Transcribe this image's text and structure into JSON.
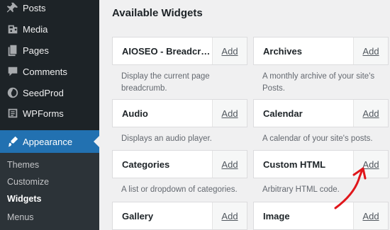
{
  "sidebar": {
    "items": [
      {
        "label": "Posts",
        "icon": "pushpin-icon"
      },
      {
        "label": "Media",
        "icon": "media-icon"
      },
      {
        "label": "Pages",
        "icon": "pages-icon"
      },
      {
        "label": "Comments",
        "icon": "comments-icon"
      },
      {
        "label": "SeedProd",
        "icon": "seedprod-icon"
      },
      {
        "label": "WPForms",
        "icon": "wpforms-icon"
      },
      {
        "label": "Appearance",
        "icon": "paintbrush-icon"
      }
    ],
    "submenu": [
      "Themes",
      "Customize",
      "Widgets",
      "Menus"
    ]
  },
  "main": {
    "title": "Available Widgets",
    "add_label": "Add",
    "widgets": [
      {
        "name": "AIOSEO - Breadcrumbs",
        "desc": "Display the current page breadcrumb."
      },
      {
        "name": "Archives",
        "desc": "A monthly archive of your site's Posts."
      },
      {
        "name": "Audio",
        "desc": "Displays an audio player."
      },
      {
        "name": "Calendar",
        "desc": "A calendar of your site's posts."
      },
      {
        "name": "Categories",
        "desc": "A list or dropdown of categories."
      },
      {
        "name": "Custom HTML",
        "desc": "Arbitrary HTML code."
      },
      {
        "name": "Gallery",
        "desc": ""
      },
      {
        "name": "Image",
        "desc": ""
      }
    ]
  },
  "colors": {
    "sidebar_bg": "#1d2327",
    "active_bg": "#2271b1",
    "annotation_arrow": "#e0161b"
  }
}
